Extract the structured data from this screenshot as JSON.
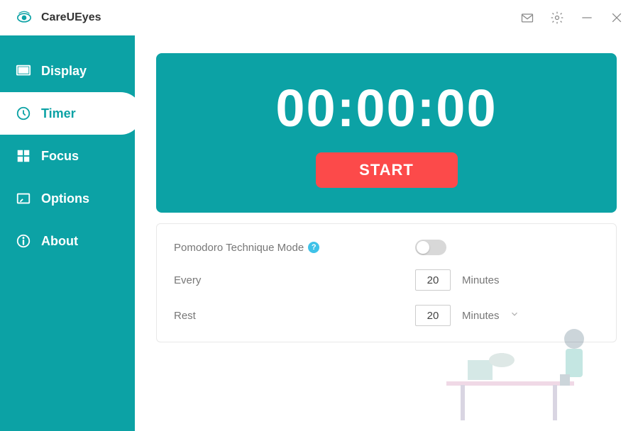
{
  "app": {
    "title": "CareUEyes"
  },
  "sidebar": {
    "items": [
      {
        "label": "Display"
      },
      {
        "label": "Timer"
      },
      {
        "label": "Focus"
      },
      {
        "label": "Options"
      },
      {
        "label": "About"
      }
    ]
  },
  "timer": {
    "display": "00:00:00",
    "start_label": "START"
  },
  "settings": {
    "pomodoro_label": "Pomodoro Technique Mode",
    "pomodoro_enabled": false,
    "every_label": "Every",
    "every_value": "20",
    "every_unit": "Minutes",
    "rest_label": "Rest",
    "rest_value": "20",
    "rest_unit": "Minutes"
  },
  "colors": {
    "primary": "#0ca2a5",
    "accent": "#fc4a4a"
  }
}
